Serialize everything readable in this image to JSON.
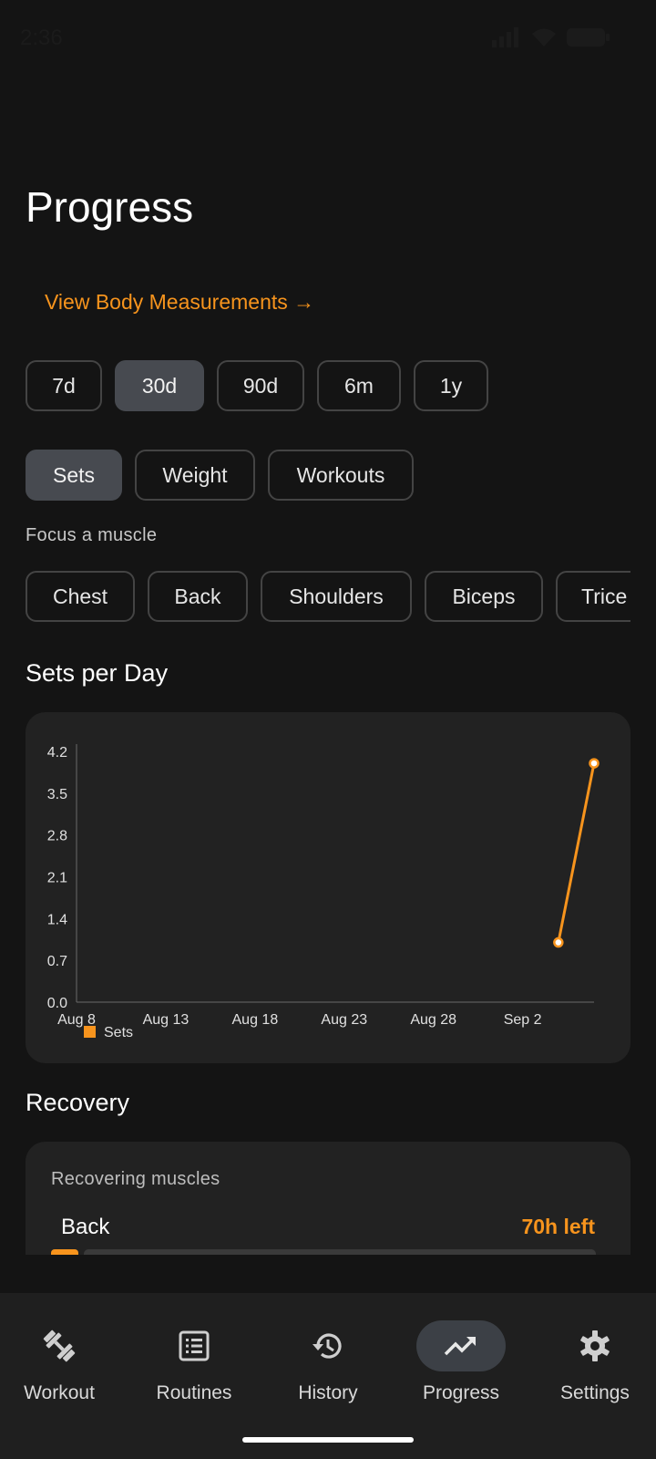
{
  "status_bar": {
    "time": "2:36"
  },
  "header": {
    "title": "Progress",
    "measurements_link": "View Body Measurements →"
  },
  "ranges": [
    {
      "label": "7d",
      "active": false
    },
    {
      "label": "30d",
      "active": true
    },
    {
      "label": "90d",
      "active": false
    },
    {
      "label": "6m",
      "active": false
    },
    {
      "label": "1y",
      "active": false
    }
  ],
  "metrics": [
    {
      "label": "Sets",
      "active": true
    },
    {
      "label": "Weight",
      "active": false
    },
    {
      "label": "Workouts",
      "active": false
    }
  ],
  "focus": {
    "label": "Focus a muscle",
    "muscles": [
      "Chest",
      "Back",
      "Shoulders",
      "Biceps",
      "Trice"
    ]
  },
  "chart_section": {
    "title": "Sets per Day"
  },
  "chart_data": {
    "type": "line",
    "title": "Sets per Day",
    "y_ticks": [
      "0.0",
      "0.7",
      "1.4",
      "2.1",
      "2.8",
      "3.5",
      "4.2"
    ],
    "x_ticks": [
      "Aug 8",
      "Aug 13",
      "Aug 18",
      "Aug 23",
      "Aug 28",
      "Sep 2"
    ],
    "ylim": [
      0,
      4.2
    ],
    "xlim": [
      "Aug 8",
      "Sep 6"
    ],
    "series": [
      {
        "name": "Sets",
        "color": "#f7941d",
        "points": [
          {
            "x": "Sep 4",
            "y": 1
          },
          {
            "x": "Sep 6",
            "y": 4
          }
        ]
      }
    ],
    "legend_position": "bottom-left",
    "grid": false
  },
  "recovery": {
    "title": "Recovery",
    "card_label": "Recovering muscles",
    "items": [
      {
        "muscle": "Back",
        "time_left": "70h left",
        "progress": 0.05
      }
    ]
  },
  "nav": [
    {
      "label": "Workout",
      "icon": "dumbbell-icon",
      "active": false
    },
    {
      "label": "Routines",
      "icon": "list-icon",
      "active": false
    },
    {
      "label": "History",
      "icon": "history-icon",
      "active": false
    },
    {
      "label": "Progress",
      "icon": "trending-up-icon",
      "active": true
    },
    {
      "label": "Settings",
      "icon": "gear-icon",
      "active": false
    }
  ],
  "colors": {
    "accent": "#f7941d",
    "background": "#141414",
    "card": "#222222"
  }
}
